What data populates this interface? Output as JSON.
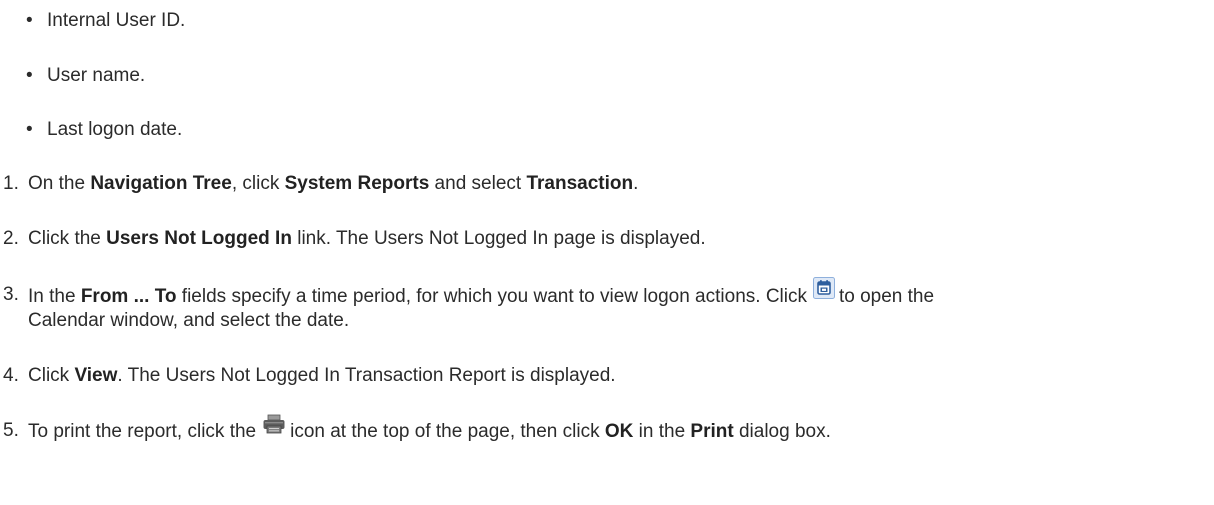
{
  "bullets": [
    {
      "text": "Internal User ID."
    },
    {
      "text": "User name."
    },
    {
      "text": "Last logon date."
    }
  ],
  "steps": [
    {
      "num": "1.",
      "parts": [
        "On the ",
        "Navigation Tree",
        ", click ",
        "System Reports",
        " and select ",
        "Transaction",
        "."
      ]
    },
    {
      "num": "2.",
      "parts": [
        "Click the ",
        "Users Not Logged In",
        " link. The Users Not Logged In page is displayed."
      ]
    },
    {
      "num": "3.",
      "parts": [
        "In the ",
        "From ... To",
        " fields specify a time period, for which you want to view logon actions. Click",
        "to  open the"
      ],
      "continuation": "Calendar window, and select the date."
    },
    {
      "num": "4.",
      "parts": [
        "Click ",
        "View",
        ". The Users Not Logged In Transaction Report is displayed."
      ]
    },
    {
      "num": "5.",
      "parts": [
        "To print the report, click the",
        "icon at the top of the page, then click ",
        "OK",
        " in the ",
        "Print",
        " dialog box."
      ]
    }
  ],
  "icons": {
    "calendar": "calendar-icon",
    "print": "printer-icon"
  },
  "colors": {
    "text": "#2b2b2b",
    "calendar_accent": "#3a78c8"
  }
}
